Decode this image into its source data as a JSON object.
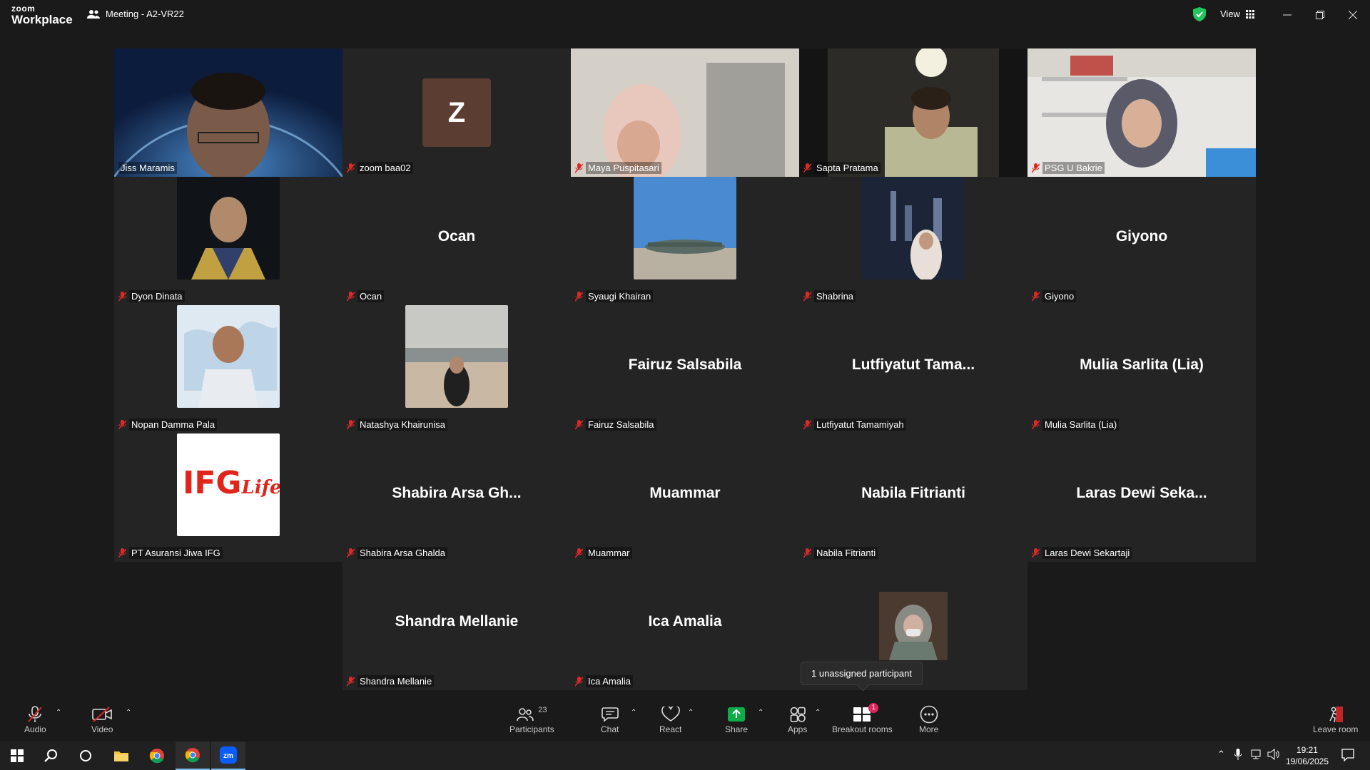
{
  "app": {
    "brand_top": "zoom",
    "brand_bottom": "Workplace",
    "meeting_title": "Meeting - A2-VR22",
    "view_label": "View"
  },
  "participants": [
    {
      "name": "Jiss Maramis",
      "kind": "video",
      "active": true
    },
    {
      "name": "zoom baa02",
      "kind": "initial",
      "initial": "Z"
    },
    {
      "name": "Maya Puspitasari",
      "kind": "video"
    },
    {
      "name": "Sapta Pratama",
      "kind": "video"
    },
    {
      "name": "PSG U Bakrie",
      "kind": "video"
    },
    {
      "name": "Dyon Dinata",
      "kind": "photo"
    },
    {
      "name": "Ocan",
      "kind": "name",
      "display": "Ocan"
    },
    {
      "name": "Syaugi Khairan",
      "kind": "photo"
    },
    {
      "name": "Shabrina",
      "kind": "photo"
    },
    {
      "name": "Giyono",
      "kind": "name",
      "display": "Giyono"
    },
    {
      "name": "Nopan Damma Pala",
      "kind": "photo"
    },
    {
      "name": "Natashya Khairunisa",
      "kind": "photo"
    },
    {
      "name": "Fairuz Salsabila",
      "kind": "name",
      "display": "Fairuz Salsabila"
    },
    {
      "name": "Lutfiyatut Tamamiyah",
      "kind": "name",
      "display": "Lutfiyatut  Tama..."
    },
    {
      "name": "Mulia Sarlita (Lia)",
      "kind": "name",
      "display": "Mulia Sarlita (Lia)"
    },
    {
      "name": "PT Asuransi Jiwa IFG",
      "kind": "logo",
      "logo_main": "IFG",
      "logo_sub": "Life"
    },
    {
      "name": "Shabira Arsa Ghalda",
      "kind": "name",
      "display": "Shabira Arsa Gh..."
    },
    {
      "name": "Muammar",
      "kind": "name",
      "display": "Muammar"
    },
    {
      "name": "Nabila Fitrianti",
      "kind": "name",
      "display": "Nabila Fitrianti"
    },
    {
      "name": "Laras Dewi Sekartaji",
      "kind": "name",
      "display": "Laras Dewi Seka..."
    },
    {
      "name": "Shandra Mellanie",
      "kind": "name",
      "display": "Shandra Mellanie"
    },
    {
      "name": "Ica Amalia",
      "kind": "name",
      "display": "Ica Amalia"
    },
    {
      "name": "",
      "kind": "photo"
    }
  ],
  "tooltip": "1 unassigned participant",
  "toolbar": {
    "audio": "Audio",
    "video": "Video",
    "participants": "Participants",
    "participants_count": "23",
    "chat": "Chat",
    "react": "React",
    "share": "Share",
    "apps": "Apps",
    "breakout": "Breakout rooms",
    "breakout_badge": "1",
    "more": "More",
    "leave": "Leave room"
  },
  "taskbar": {
    "time": "19:21",
    "date": "19/06/2025"
  },
  "colors": {
    "active_speaker": "#23d9a0",
    "share_green": "#0eab4a",
    "mute_red": "#e02828",
    "badge": "#e0245e"
  }
}
